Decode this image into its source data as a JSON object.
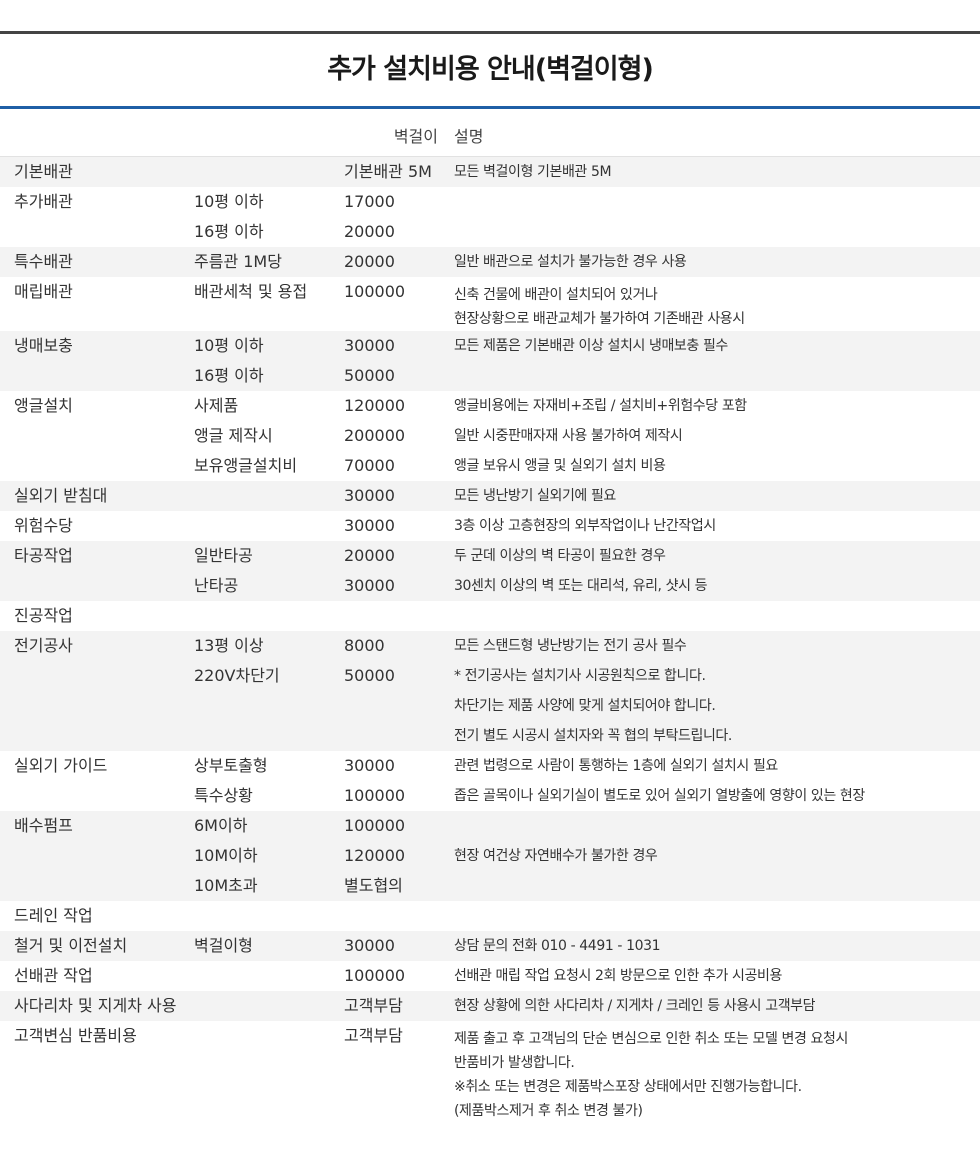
{
  "title": "추가 설치비용 안내(벽걸이형)",
  "header": {
    "col_price": "벽걸이",
    "col_desc": "설명"
  },
  "rows": [
    {
      "category": "기본배관",
      "sub": [
        {
          "option": "",
          "price": "기본배관 5M",
          "desc": "모든 벽걸이형 기본배관 5M"
        }
      ]
    },
    {
      "category": "추가배관",
      "sub": [
        {
          "option": "10평 이하",
          "price": "17000",
          "desc": ""
        },
        {
          "option": "16평 이하",
          "price": "20000",
          "desc": ""
        }
      ]
    },
    {
      "category": "특수배관",
      "sub": [
        {
          "option": "주름관 1M당",
          "price": "20000",
          "desc": "일반 배관으로 설치가 불가능한 경우 사용"
        }
      ]
    },
    {
      "category": "매립배관",
      "sub": [
        {
          "option": "배관세척 및 용접",
          "price": "100000",
          "desc": ""
        }
      ],
      "desc_block": [
        "신축 건물에 배관이 설치되어 있거나",
        "현장상황으로 배관교체가 불가하여 기존배관 사용시"
      ]
    },
    {
      "category": "냉매보충",
      "sub": [
        {
          "option": "10평 이하",
          "price": "30000",
          "desc": "모든 제품은 기본배관 이상 설치시 냉매보충 필수"
        },
        {
          "option": "16평 이하",
          "price": "50000",
          "desc": ""
        }
      ]
    },
    {
      "category": "앵글설치",
      "sub": [
        {
          "option": "사제품",
          "price": "120000",
          "desc": "앵글비용에는 자재비+조립 / 설치비+위험수당 포함"
        },
        {
          "option": "앵글 제작시",
          "price": "200000",
          "desc": "일반 시중판매자재 사용 불가하여 제작시"
        },
        {
          "option": "보유앵글설치비",
          "price": "70000",
          "desc": "앵글 보유시 앵글 및 실외기 설치 비용"
        }
      ]
    },
    {
      "category": "실외기 받침대",
      "sub": [
        {
          "option": "",
          "price": "30000",
          "desc": "모든 냉난방기 실외기에 필요"
        }
      ]
    },
    {
      "category": "위험수당",
      "sub": [
        {
          "option": "",
          "price": "30000",
          "desc": "3층 이상 고층현장의 외부작업이나 난간작업시"
        }
      ]
    },
    {
      "category": "타공작업",
      "sub": [
        {
          "option": "일반타공",
          "price": "20000",
          "desc": "두 군데 이상의 벽 타공이 필요한 경우"
        },
        {
          "option": "난타공",
          "price": "30000",
          "desc": "30센치 이상의 벽 또는 대리석, 유리, 샷시 등"
        }
      ]
    },
    {
      "category": "진공작업",
      "sub": [
        {
          "option": "",
          "price": "",
          "desc": ""
        }
      ]
    },
    {
      "category": "전기공사",
      "sub": [
        {
          "option": "13평 이상",
          "price": "8000",
          "desc": "모든 스탠드형 냉난방기는 전기 공사 필수"
        },
        {
          "option": "220V차단기",
          "price": "50000",
          "desc": "* 전기공사는 설치기사 시공원칙으로 합니다."
        },
        {
          "option": "",
          "price": "",
          "desc": "차단기는 제품 사양에 맞게 설치되어야 합니다."
        },
        {
          "option": "",
          "price": "",
          "desc": "전기 별도 시공시 설치자와 꼭 협의 부탁드립니다."
        }
      ]
    },
    {
      "category": "실외기 가이드",
      "sub": [
        {
          "option": "상부토출형",
          "price": "30000",
          "desc": "관련 법령으로 사람이 통행하는 1층에 실외기 설치시 필요"
        },
        {
          "option": "특수상황",
          "price": "100000",
          "desc": "좁은 골목이나 실외기실이 별도로 있어 실외기 열방출에 영향이 있는 현장"
        }
      ]
    },
    {
      "category": "배수펌프",
      "sub": [
        {
          "option": "6M이하",
          "price": "100000",
          "desc": ""
        },
        {
          "option": "10M이하",
          "price": "120000",
          "desc": "현장 여건상 자연배수가 불가한 경우"
        },
        {
          "option": "10M초과",
          "price": "별도협의",
          "desc": ""
        }
      ]
    },
    {
      "category": "드레인 작업",
      "sub": [
        {
          "option": "",
          "price": "",
          "desc": ""
        }
      ]
    },
    {
      "category": "철거 및 이전설치",
      "sub": [
        {
          "option": "벽걸이형",
          "price": "30000",
          "desc": "상담 문의 전화 010 - 4491 - 1031"
        }
      ]
    },
    {
      "category": "선배관 작업",
      "sub": [
        {
          "option": "",
          "price": "100000",
          "desc": "선배관 매립 작업 요청시 2회 방문으로 인한 추가 시공비용"
        }
      ]
    },
    {
      "category": "사다리차 및 지게차 사용",
      "sub": [
        {
          "option": "",
          "price": "고객부담",
          "desc": "현장 상황에 의한 사다리차 / 지게차 / 크레인 등 사용시 고객부담"
        }
      ]
    },
    {
      "category": "고객변심 반품비용",
      "sub": [
        {
          "option": "",
          "price": "고객부담",
          "desc": ""
        }
      ],
      "desc_block": [
        "제품 출고 후 고객님의 단순 변심으로 인한 취소 또는 모델 변경 요청시",
        "반품비가 발생합니다.",
        "※취소 또는 변경은 제품박스포장 상태에서만 진행가능합니다.",
        "(제품박스제거 후 취소 변경 불가)"
      ]
    }
  ]
}
